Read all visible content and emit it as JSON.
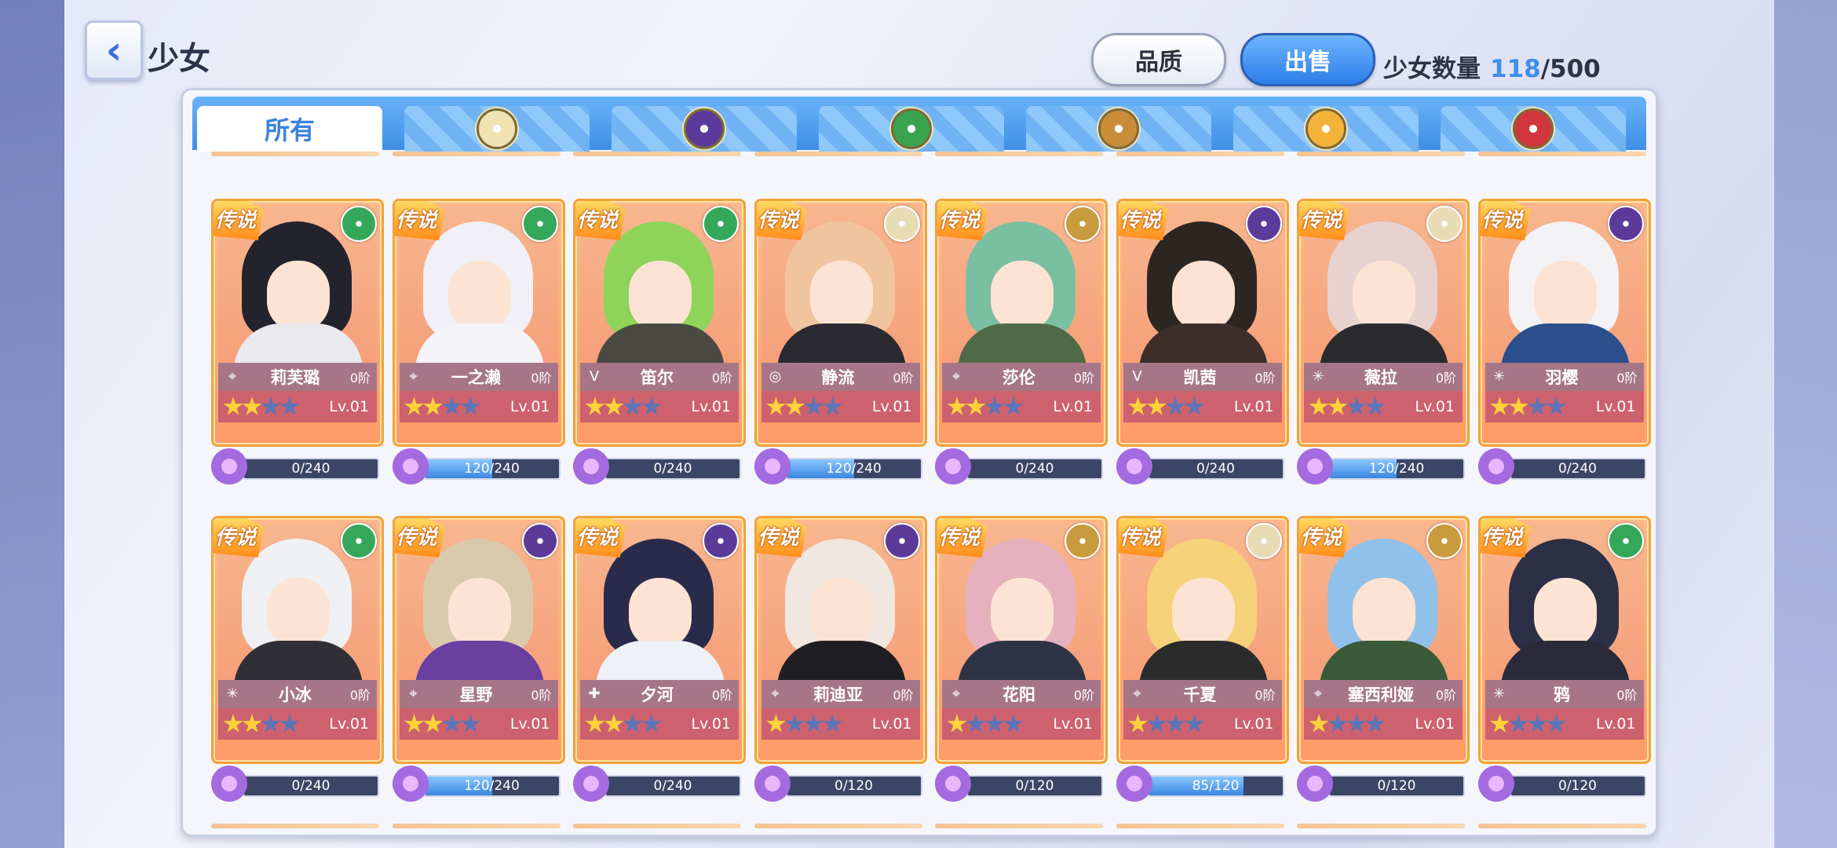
{
  "header": {
    "title": "少女",
    "back_icon": "‹",
    "quality_label": "品质",
    "sell_label": "出售",
    "count_label": "少女数量",
    "count_current": "118",
    "count_max": "/500"
  },
  "tabs": [
    {
      "label": "所有",
      "active": true
    },
    {
      "label": "",
      "emblem": "light-element-icon",
      "color": "#f1e2b4"
    },
    {
      "label": "",
      "emblem": "dark-element-icon",
      "color": "#5b3a9a"
    },
    {
      "label": "",
      "emblem": "wind-element-icon",
      "color": "#3aa34f"
    },
    {
      "label": "",
      "emblem": "earth-element-icon",
      "color": "#c98d3a"
    },
    {
      "label": "",
      "emblem": "fire-sun-element-icon",
      "color": "#f3b33a"
    },
    {
      "label": "",
      "emblem": "fire-element-icon",
      "color": "#d0363b"
    }
  ],
  "legend_text": "传说",
  "level_text": "Lv.01",
  "cards": [
    {
      "name": "莉芙璐",
      "rank": "0阶",
      "stars": 2,
      "element": "#35a75a",
      "hair": "#23232e",
      "outfit": "#e9e9ee",
      "class_icon": "⌖",
      "frag": "0/240",
      "fill": 0
    },
    {
      "name": "一之濑",
      "rank": "0阶",
      "stars": 2,
      "element": "#35a75a",
      "hair": "#f0f0f6",
      "outfit": "#f3f3f8",
      "class_icon": "⌖",
      "frag": "120/240",
      "fill": 0.5
    },
    {
      "name": "笛尔",
      "rank": "0阶",
      "stars": 2,
      "element": "#35a75a",
      "hair": "#8ed45a",
      "outfit": "#4a4a42",
      "class_icon": "V",
      "frag": "0/240",
      "fill": 0
    },
    {
      "name": "静流",
      "rank": "0阶",
      "stars": 2,
      "element": "#e8dcb5",
      "hair": "#f0c59e",
      "outfit": "#2a2a30",
      "class_icon": "◎",
      "frag": "120/240",
      "fill": 0.5
    },
    {
      "name": "莎伦",
      "rank": "0阶",
      "stars": 2,
      "element": "#c99b3f",
      "hair": "#7bbfa2",
      "outfit": "#4f6a47",
      "class_icon": "⌖",
      "frag": "0/240",
      "fill": 0
    },
    {
      "name": "凯茜",
      "rank": "0阶",
      "stars": 2,
      "element": "#5b3a9a",
      "hair": "#2b2622",
      "outfit": "#3d2e2a",
      "class_icon": "V",
      "frag": "0/240",
      "fill": 0
    },
    {
      "name": "薇拉",
      "rank": "0阶",
      "stars": 2,
      "element": "#e8dcb5",
      "hair": "#e8d2cf",
      "outfit": "#2b2b2f",
      "class_icon": "✳",
      "frag": "120/240",
      "fill": 0.5
    },
    {
      "name": "羽樱",
      "rank": "0阶",
      "stars": 2,
      "element": "#5b3a9a",
      "hair": "#f3f3f6",
      "outfit": "#2a4f8c",
      "class_icon": "✳",
      "frag": "0/240",
      "fill": 0
    },
    {
      "name": "小冰",
      "rank": "0阶",
      "stars": 2,
      "element": "#35a75a",
      "hair": "#eef0f4",
      "outfit": "#2f2f35",
      "class_icon": "✳",
      "frag": "0/240",
      "fill": 0
    },
    {
      "name": "星野",
      "rank": "0阶",
      "stars": 2,
      "element": "#5b3a9a",
      "hair": "#d9c9ad",
      "outfit": "#6a3fa0",
      "class_icon": "⌖",
      "frag": "120/240",
      "fill": 0.5
    },
    {
      "name": "夕河",
      "rank": "0阶",
      "stars": 2,
      "element": "#5b3a9a",
      "hair": "#2a2b4a",
      "outfit": "#eef2f8",
      "class_icon": "✚",
      "frag": "0/240",
      "fill": 0
    },
    {
      "name": "莉迪亚",
      "rank": "0阶",
      "stars": 1,
      "element": "#5b3a9a",
      "hair": "#efe7e0",
      "outfit": "#1f1f23",
      "class_icon": "⌖",
      "frag": "0/120",
      "fill": 0
    },
    {
      "name": "花阳",
      "rank": "0阶",
      "stars": 1,
      "element": "#c99b3f",
      "hair": "#e6b1bf",
      "outfit": "#2f3346",
      "class_icon": "⌖",
      "frag": "0/120",
      "fill": 0
    },
    {
      "name": "千夏",
      "rank": "0阶",
      "stars": 1,
      "element": "#e8dcb5",
      "hair": "#f5d27a",
      "outfit": "#2b2b2b",
      "class_icon": "⌖",
      "frag": "85/120",
      "fill": 0.7083
    },
    {
      "name": "塞西利娅",
      "rank": "0阶",
      "stars": 1,
      "element": "#c99b3f",
      "hair": "#8fc1ea",
      "outfit": "#3a5a3a",
      "class_icon": "⌖",
      "frag": "0/120",
      "fill": 0
    },
    {
      "name": "鸦",
      "rank": "0阶",
      "stars": 1,
      "element": "#35a75a",
      "hair": "#2c2f45",
      "outfit": "#2a2a3a",
      "class_icon": "✳",
      "frag": "0/120",
      "fill": 0
    }
  ]
}
